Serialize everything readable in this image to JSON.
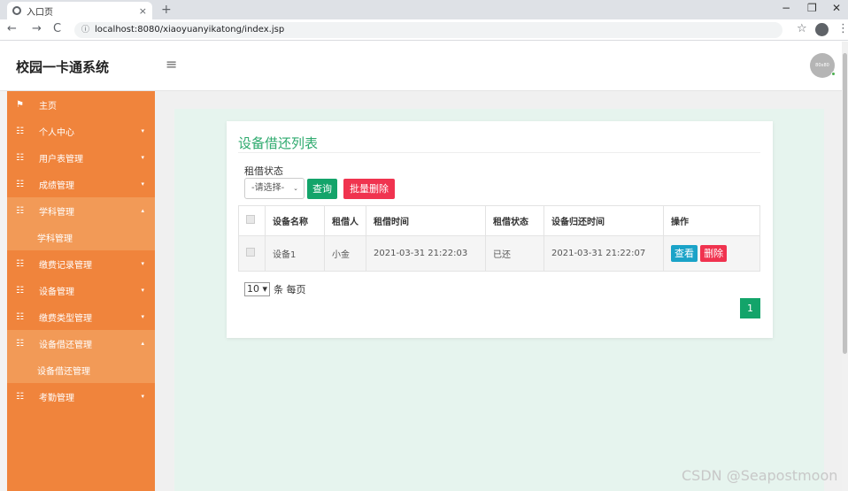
{
  "browser": {
    "tab_title": "入口页",
    "tab_close": "×",
    "new_tab": "+",
    "url": "localhost:8080/xiaoyuanyikatong/index.jsp",
    "nav_back": "←",
    "nav_forward": "→",
    "nav_reload": "C",
    "info": "ⓘ",
    "star": "☆",
    "menu": "⋮",
    "win_min": "−",
    "win_max": "❐",
    "win_close": "✕"
  },
  "header": {
    "brand": "校园一卡通系统",
    "hamburger": "≡",
    "avatar_text": "80x80"
  },
  "sidebar": {
    "items": [
      {
        "label": "主页",
        "icon": "flag-icon",
        "glyph": "⚑",
        "arrow": "",
        "active": false
      },
      {
        "label": "个人中心",
        "icon": "grid-icon",
        "glyph": "☷",
        "arrow": "▾",
        "active": false
      },
      {
        "label": "用户表管理",
        "icon": "grid-icon",
        "glyph": "☷",
        "arrow": "▾",
        "active": false
      },
      {
        "label": "成绩管理",
        "icon": "grid-icon",
        "glyph": "☷",
        "arrow": "▾",
        "active": false
      },
      {
        "label": "学科管理",
        "icon": "grid-icon",
        "glyph": "☷",
        "arrow": "▴",
        "active": true
      },
      {
        "label": "学科管理",
        "sub": true
      },
      {
        "label": "缴费记录管理",
        "icon": "grid-icon",
        "glyph": "☷",
        "arrow": "▾",
        "active": false
      },
      {
        "label": "设备管理",
        "icon": "grid-icon",
        "glyph": "☷",
        "arrow": "▾",
        "active": false
      },
      {
        "label": "缴费类型管理",
        "icon": "grid-icon",
        "glyph": "☷",
        "arrow": "▾",
        "active": false
      },
      {
        "label": "设备借还管理",
        "icon": "grid-icon",
        "glyph": "☷",
        "arrow": "▴",
        "active": true
      },
      {
        "label": "设备借还管理",
        "sub": true
      },
      {
        "label": "考勤管理",
        "icon": "grid-icon",
        "glyph": "☷",
        "arrow": "▾",
        "active": false
      }
    ]
  },
  "main": {
    "title": "设备借还列表",
    "filter_label": "租借状态",
    "select_value": "-请选择-",
    "select_caret": "⌄",
    "search_button": "查询",
    "batch_delete_button": "批量删除",
    "table": {
      "columns": [
        "",
        "设备名称",
        "租借人",
        "租借时间",
        "租借状态",
        "设备归还时间",
        "操作"
      ],
      "rows": [
        {
          "name": "设备1",
          "borrower": "小金",
          "borrow_time": "2021-03-31 21:22:03",
          "status": "已还",
          "return_time": "2021-03-31 21:22:07",
          "view": "查看",
          "delete": "删除"
        }
      ]
    },
    "page_size_value": "10",
    "page_size_caret": "▾",
    "page_size_suffix": "条 每页",
    "current_page": "1"
  },
  "watermark": "CSDN @Seapostmoon",
  "colors": {
    "sidebar": "#f0843c",
    "sidebar_active": "#f29a57",
    "accent_green": "#13a46a",
    "danger_red": "#f0334f",
    "view_blue": "#1aa3c8",
    "content_bg": "#e6f4ee"
  }
}
